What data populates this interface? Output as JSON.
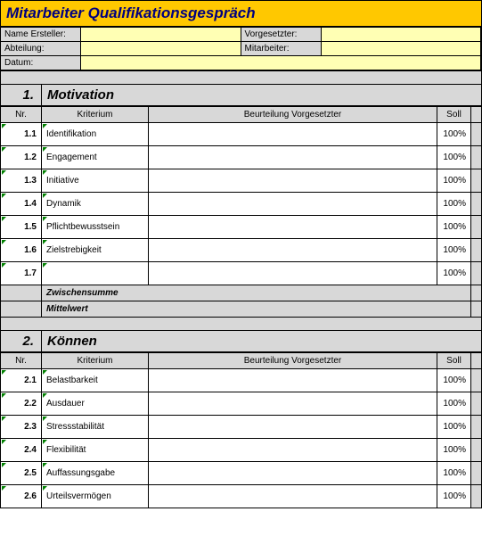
{
  "title": "Mitarbeiter Qualifikationsgespräch",
  "meta": {
    "name_label": "Name Ersteller:",
    "name_value": "",
    "vorg_label": "Vorgesetzter:",
    "vorg_value": "",
    "abt_label": "Abteilung:",
    "abt_value": "",
    "mit_label": "Mitarbeiter:",
    "mit_value": "",
    "datum_label": "Datum:",
    "datum_value": ""
  },
  "columns": {
    "nr": "Nr.",
    "kriterium": "Kriterium",
    "beurteilung": "Beurteilung Vorgesetzter",
    "soll": "Soll"
  },
  "summary": {
    "zwischensumme": "Zwischensumme",
    "mittelwert": "Mittelwert"
  },
  "sections": [
    {
      "num": "1.",
      "label": "Motivation",
      "rows": [
        {
          "nr": "1.1",
          "krit": "Identifikation",
          "bew": "",
          "soll": "100%"
        },
        {
          "nr": "1.2",
          "krit": "Engagement",
          "bew": "",
          "soll": "100%"
        },
        {
          "nr": "1.3",
          "krit": "Initiative",
          "bew": "",
          "soll": "100%"
        },
        {
          "nr": "1.4",
          "krit": "Dynamik",
          "bew": "",
          "soll": "100%"
        },
        {
          "nr": "1.5",
          "krit": "Pflichtbewusstsein",
          "bew": "",
          "soll": "100%"
        },
        {
          "nr": "1.6",
          "krit": "Zielstrebigkeit",
          "bew": "",
          "soll": "100%"
        },
        {
          "nr": "1.7",
          "krit": "",
          "bew": "",
          "soll": "100%"
        }
      ]
    },
    {
      "num": "2.",
      "label": "Können",
      "rows": [
        {
          "nr": "2.1",
          "krit": "Belastbarkeit",
          "bew": "",
          "soll": "100%"
        },
        {
          "nr": "2.2",
          "krit": "Ausdauer",
          "bew": "",
          "soll": "100%"
        },
        {
          "nr": "2.3",
          "krit": "Stressstabilität",
          "bew": "",
          "soll": "100%"
        },
        {
          "nr": "2.4",
          "krit": "Flexibilität",
          "bew": "",
          "soll": "100%"
        },
        {
          "nr": "2.5",
          "krit": "Auffassungsgabe",
          "bew": "",
          "soll": "100%"
        },
        {
          "nr": "2.6",
          "krit": "Urteilsvermögen",
          "bew": "",
          "soll": "100%"
        }
      ]
    }
  ]
}
